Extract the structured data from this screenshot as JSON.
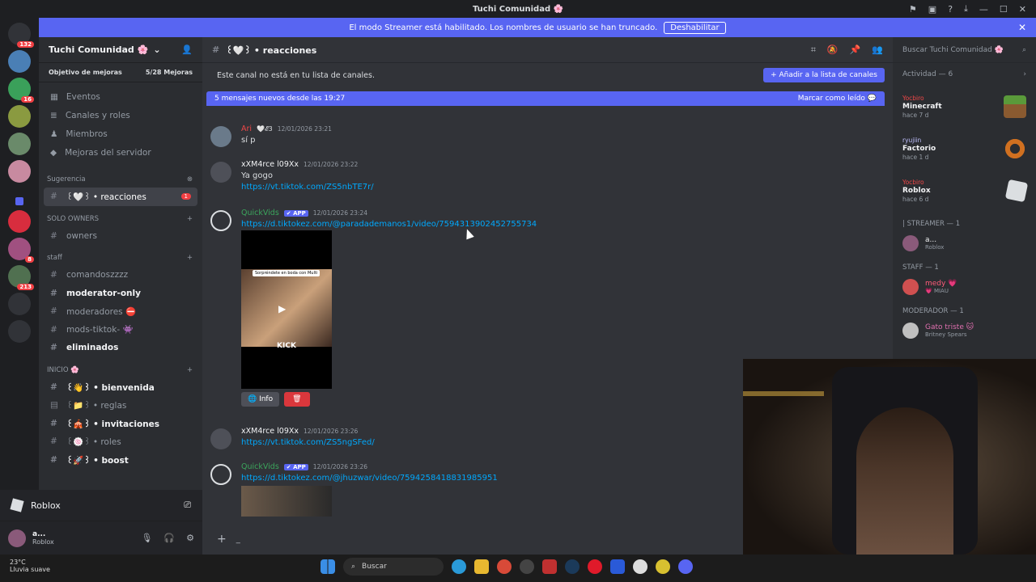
{
  "window": {
    "title": "Tuchi Comunidad 🌸"
  },
  "banner": {
    "text": "El modo Streamer está habilitado. Los nombres de usuario se han truncado.",
    "button": "Deshabilitar"
  },
  "guild": {
    "name": "Tuchi Comunidad 🌸",
    "boost_label": "Objetivo de mejoras",
    "boost_count": "5/28 Mejoras"
  },
  "nav": {
    "events": "Eventos",
    "channels": "Canales y roles",
    "members": "Miembros",
    "boosts": "Mejoras del servidor"
  },
  "categories": {
    "suggestion": "Sugerencia",
    "solo_owners": "SOLO OWNERS",
    "staff": "staff",
    "inicio": "INICIO 🌸"
  },
  "channels": {
    "reacciones": "꒰🤍꒱ • reacciones",
    "reacciones_badge": "1",
    "owners": "owners",
    "comandos": "comandoszzzz",
    "moderator_only": "moderator-only",
    "moderadores": "moderadores ⛔",
    "mods_tiktok": "mods-tiktok- 👾",
    "eliminados": "eliminados",
    "bienvenida": "꒰👋꒱ • bienvenida",
    "reglas": "꒰📁꒱ • reglas",
    "invitaciones": "꒰🎪꒱ • invitaciones",
    "roles": "꒰🍥꒱ • roles",
    "boost": "꒰🚀꒱ • boost"
  },
  "voice": {
    "label": "Roblox"
  },
  "user": {
    "name": "a...",
    "status": "Roblox"
  },
  "header": {
    "channel": "꒰🤍꒱ • reacciones"
  },
  "notice": {
    "text": "Este canal no está en tu lista de canales.",
    "button": "Añadir a la lista de canales"
  },
  "newbar": {
    "text": "5 mensajes nuevos desde las 19:27",
    "mark": "Marcar como leído"
  },
  "messages": [
    {
      "author": "Ari",
      "tag": "🤍𝓔3",
      "time": "12/01/2026 23:21",
      "text": "sí p"
    },
    {
      "author": "xXM4rce l09Xx",
      "time": "12/01/2026 23:22",
      "text": "Ya gogo",
      "link": "https://vt.tiktok.com/ZS5nbTE7r/"
    },
    {
      "author": "QuickVids",
      "app": "✔ APP",
      "time": "12/01/2026 23:24",
      "link": "https://d.tiktokez.com/@paradademanos1/video/7594313902452755734",
      "embed_caption": "Sorpréndete en boda con Multi",
      "embed_label": "KICK",
      "btn_info": "Info",
      "btn_delete": "🗑"
    },
    {
      "author": "xXM4rce l09Xx",
      "time": "12/01/2026 23:26",
      "link": "https://vt.tiktok.com/ZS5ngSFed/"
    },
    {
      "author": "QuickVids",
      "app": "✔ APP",
      "time": "12/01/2026 23:26",
      "link": "https://d.tiktokez.com/@jhuzwar/video/7594258418831985951"
    }
  ],
  "side": {
    "search": "Buscar Tuchi Comunidad 🌸",
    "activity": "Actividad — 6",
    "activities": [
      {
        "user": "Yocbiro",
        "game": "Minecraft",
        "time": "hace 7 d"
      },
      {
        "user": "ryujiin",
        "game": "Factorio",
        "time": "hace 1 d"
      },
      {
        "user": "Yocbiro",
        "game": "Roblox",
        "time": "hace 6 d"
      }
    ],
    "roles": [
      {
        "name": "| STREAMER — 1",
        "member": "a...",
        "sub": "Roblox"
      },
      {
        "name": "STAFF — 1",
        "member": "medy 💗",
        "sub": "💗 MIAU"
      },
      {
        "name": "MODERADOR — 1",
        "member": "Gato triste 🐱",
        "sub": "Britney Spears"
      }
    ]
  },
  "taskbar": {
    "temp": "23°C",
    "weather": "Lluvia suave",
    "search": "Buscar"
  },
  "colors": {
    "accent": "#5865f2",
    "link": "#00a8fc",
    "bg": "#313338"
  }
}
